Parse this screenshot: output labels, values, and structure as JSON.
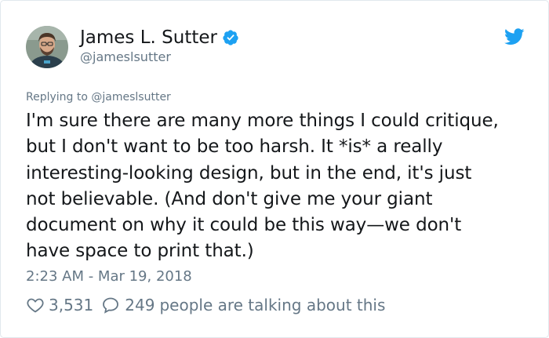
{
  "author": {
    "display_name": "James L. Sutter",
    "handle": "@jameslsutter",
    "verified": true,
    "avatar": "avatar-photo"
  },
  "brand": {
    "icon": "twitter-bird-icon",
    "color": "#1da1f2"
  },
  "reply": {
    "prefix": "Replying to",
    "to_handle": "@jameslsutter"
  },
  "tweet": {
    "text": "I'm sure there are many more things I could critique,\nbut I don't want to be too harsh. It *is* a really\ninteresting-looking design, but in the end, it's just\nnot believable. (And don't give me your giant\ndocument on why it could be this way—we don't\nhave space to print that.)",
    "timestamp": "2:23 AM - Mar 19, 2018"
  },
  "engagement": {
    "likes": "3,531",
    "replies": "249",
    "talking_text": "people are talking about this",
    "like_icon": "heart-icon",
    "reply_icon": "speech-bubble-icon"
  },
  "colors": {
    "text_primary": "#14171a",
    "text_secondary": "#657786",
    "verified_badge": "#1da1f2",
    "border": "#e1e8ed"
  }
}
